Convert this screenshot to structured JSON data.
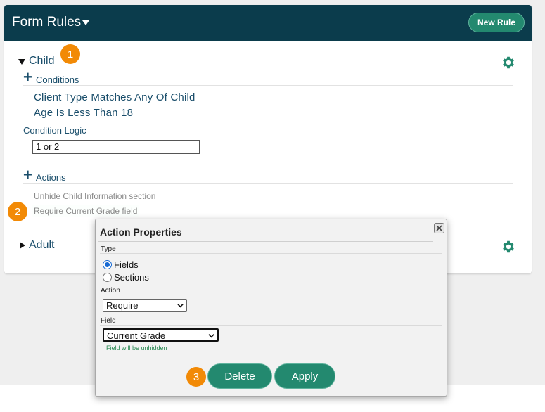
{
  "header": {
    "title": "Form Rules",
    "new_rule_label": "New Rule"
  },
  "colors": {
    "header_bg": "#0b3c4c",
    "accent": "#23896f",
    "badge": "#f28a06",
    "link_text": "#1a4e6b"
  },
  "rules": [
    {
      "name": "Child",
      "expanded": true,
      "badge": "1",
      "conditions_label": "Conditions",
      "conditions": [
        "Client Type Matches Any Of Child",
        "Age Is Less Than 18"
      ],
      "condition_logic_label": "Condition Logic",
      "condition_logic_value": "1 or 2",
      "actions_label": "Actions",
      "actions": [
        "Unhide Child Information section",
        "Require Current Grade field"
      ],
      "selected_action_badge": "2"
    },
    {
      "name": "Adult",
      "expanded": false
    }
  ],
  "dialog": {
    "title": "Action Properties",
    "type_label": "Type",
    "type_options": [
      "Fields",
      "Sections"
    ],
    "type_selected": "Fields",
    "action_label": "Action",
    "action_value": "Require",
    "field_label": "Field",
    "field_value": "Current Grade",
    "hint": "Field will be unhidden",
    "delete_label": "Delete",
    "apply_label": "Apply",
    "delete_badge": "3"
  },
  "icons": [
    "caret-down-icon",
    "gear-icon",
    "plus-icon",
    "close-icon",
    "chevron-down-icon",
    "triangle-down-icon",
    "triangle-right-icon"
  ]
}
